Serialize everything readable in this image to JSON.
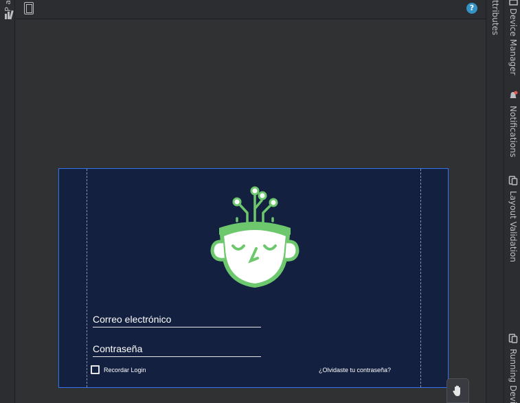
{
  "left_panel": {
    "tab_label": "P a"
  },
  "right_rail": {
    "label": "ttributes"
  },
  "right_strip": {
    "items": [
      {
        "label": "Device Manager",
        "icon": "device-manager-icon"
      },
      {
        "label": "Notifications",
        "icon": "bell-icon"
      },
      {
        "label": "Layout Validation",
        "icon": "layout-validation-icon"
      },
      {
        "label": "Running Devi",
        "icon": "running-devices-icon"
      }
    ]
  },
  "toolbar": {
    "help_label": "?"
  },
  "form": {
    "email_placeholder": "Correo electrónico",
    "password_placeholder": "Contraseña",
    "remember_label": "Recordar Login",
    "forgot_label": "¿Olvidaste tu contraseña?"
  },
  "colors": {
    "device_bg": "#13203f",
    "logo_green": "#6dc86d",
    "selection_blue": "#3574f0",
    "ide_bg": "#2b2d30"
  }
}
